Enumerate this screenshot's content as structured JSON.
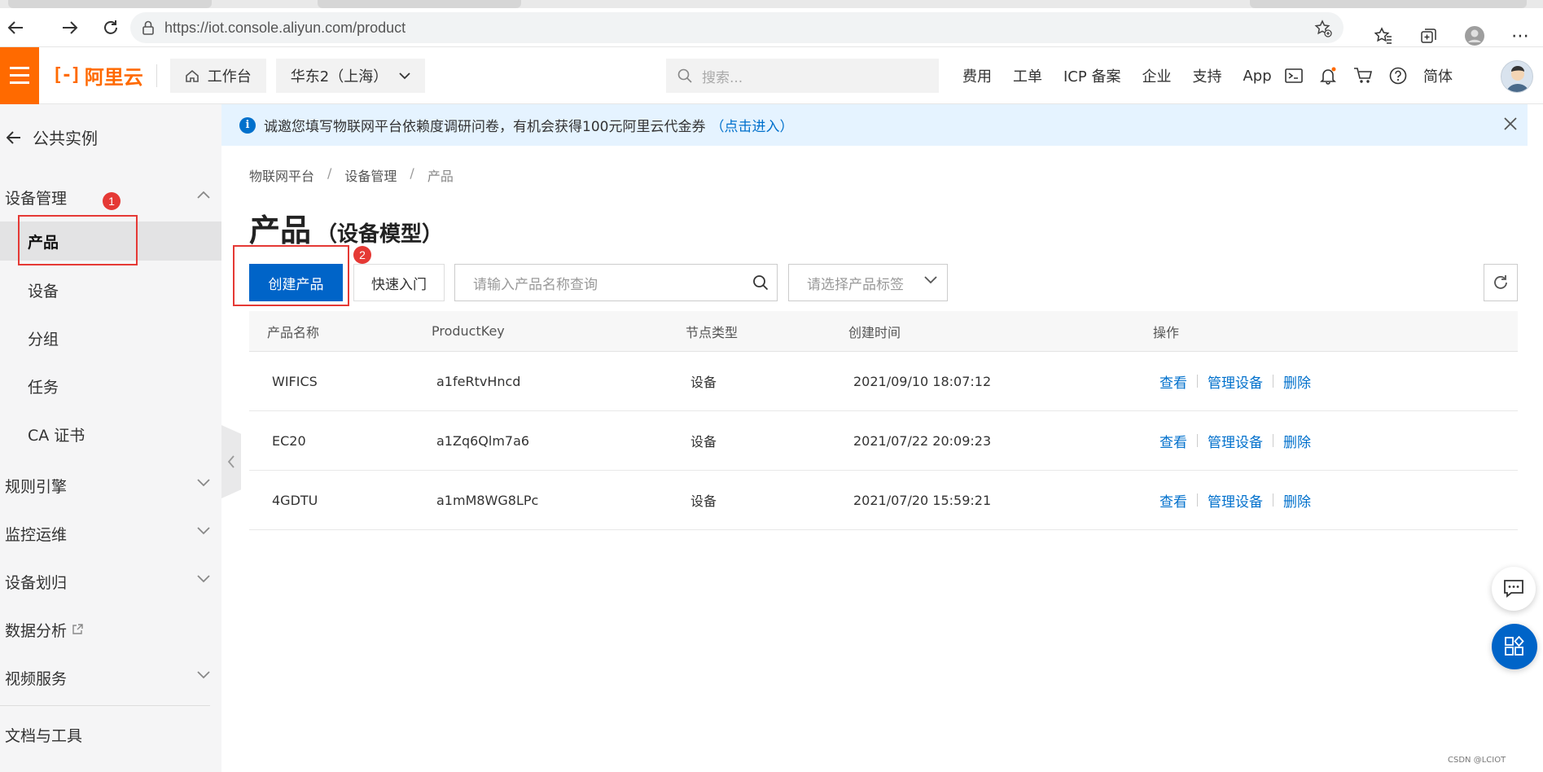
{
  "browser": {
    "url": "https://iot.console.aliyun.com/product"
  },
  "topnav": {
    "logo_text": "阿里云",
    "workbench": "工作台",
    "region": "华东2（上海）",
    "search_placeholder": "搜索...",
    "links": [
      "费用",
      "工单",
      "ICP 备案",
      "企业",
      "支持",
      "App"
    ],
    "language": "简体"
  },
  "sidebar": {
    "back_label": "公共实例",
    "group_device": "设备管理",
    "items": [
      "产品",
      "设备",
      "分组",
      "任务",
      "CA 证书"
    ],
    "groups": [
      "规则引擎",
      "监控运维",
      "设备划归",
      "数据分析",
      "视频服务"
    ],
    "docs": "文档与工具"
  },
  "annotations": {
    "badge1": "1",
    "badge2": "2"
  },
  "notice": {
    "text": "诚邀您填写物联网平台依赖度调研问卷，有机会获得100元阿里云代金券",
    "link": "（点击进入）"
  },
  "breadcrumb": [
    "物联网平台",
    "设备管理",
    "产品"
  ],
  "page": {
    "title": "产品",
    "subtitle": "（设备模型）"
  },
  "toolbar": {
    "create": "创建产品",
    "quickstart": "快速入门",
    "search_placeholder": "请输入产品名称查询",
    "tag_placeholder": "请选择产品标签"
  },
  "table": {
    "columns": [
      "产品名称",
      "ProductKey",
      "节点类型",
      "创建时间",
      "操作"
    ],
    "rows": [
      {
        "name": "WIFICS",
        "key": "a1feRtvHncd",
        "type": "设备",
        "time": "2021/09/10 18:07:12"
      },
      {
        "name": "EC20",
        "key": "a1Zq6Qlm7a6",
        "type": "设备",
        "time": "2021/07/22 20:09:23"
      },
      {
        "name": "4GDTU",
        "key": "a1mM8WG8LPc",
        "type": "设备",
        "time": "2021/07/20 15:59:21"
      }
    ],
    "actions": [
      "查看",
      "管理设备",
      "删除"
    ]
  },
  "watermark": "CSDN @LCIOT",
  "colors": {
    "brand": "#ff6a00",
    "primary": "#0064c8",
    "link": "#0070cc",
    "annotation": "#e53935"
  }
}
